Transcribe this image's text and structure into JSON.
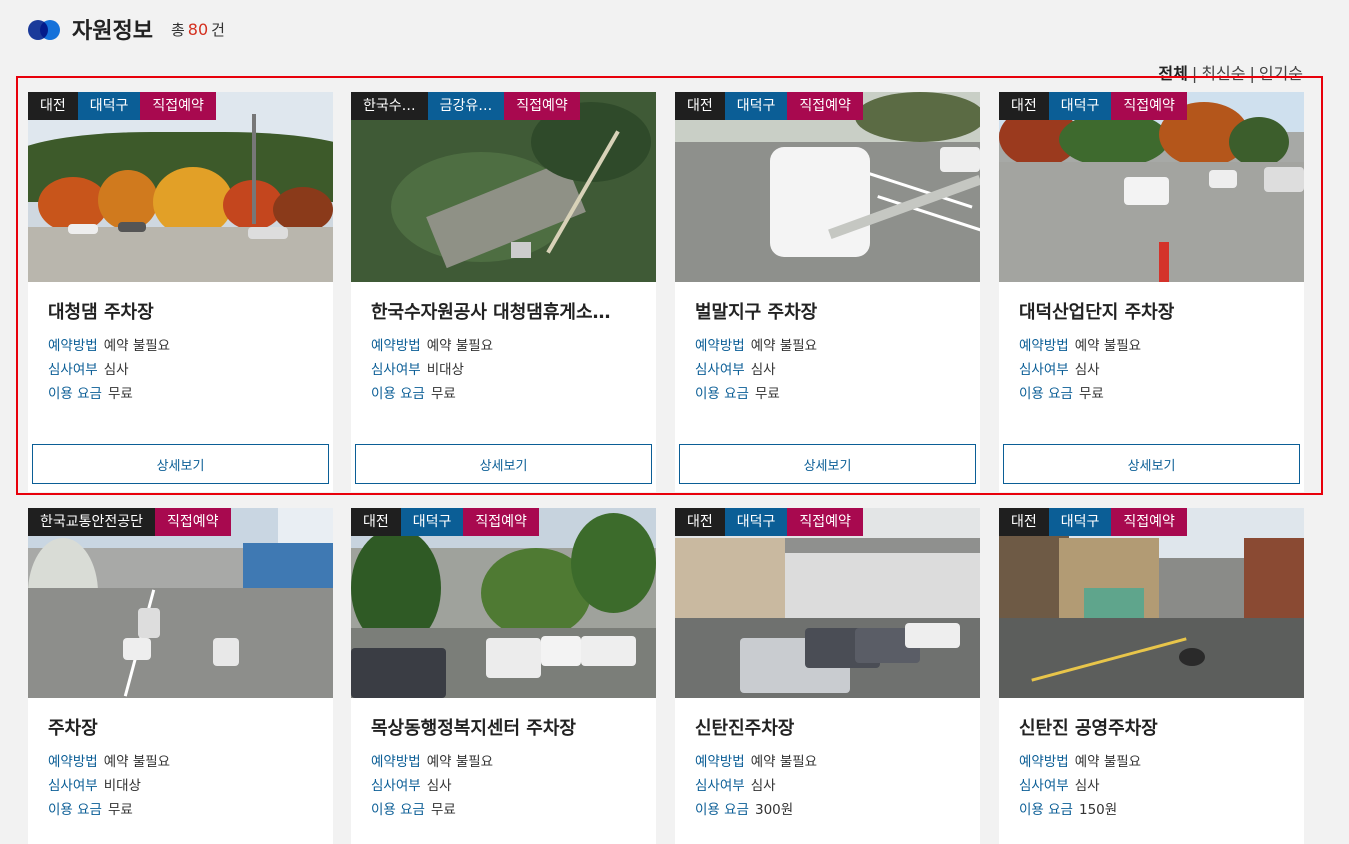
{
  "header": {
    "title": "자원정보",
    "total_prefix": "총",
    "total_count": "80",
    "total_suffix": "건"
  },
  "sort": {
    "options": [
      "전체",
      "최신순",
      "인기순"
    ],
    "separator": "|",
    "active": "전체"
  },
  "labels": {
    "reservation_method": "예약방법",
    "review": "심사여부",
    "fee": "이용 요금",
    "detail_button": "상세보기"
  },
  "cards": [
    {
      "tags": [
        "대전",
        "대덕구",
        "직접예약"
      ],
      "name": "대청댐 주차장",
      "reservation_method": "예약 불필요",
      "review": "심사",
      "fee": "무료"
    },
    {
      "tags": [
        "한국수…",
        "금강유…",
        "직접예약"
      ],
      "name": "한국수자원공사 대청댐휴게소…",
      "reservation_method": "예약 불필요",
      "review": "비대상",
      "fee": "무료"
    },
    {
      "tags": [
        "대전",
        "대덕구",
        "직접예약"
      ],
      "name": "벌말지구 주차장",
      "reservation_method": "예약 불필요",
      "review": "심사",
      "fee": "무료"
    },
    {
      "tags": [
        "대전",
        "대덕구",
        "직접예약"
      ],
      "name": "대덕산업단지 주차장",
      "reservation_method": "예약 불필요",
      "review": "심사",
      "fee": "무료"
    },
    {
      "tags": [
        "한국교통안전공단",
        "직접예약"
      ],
      "name": "주차장",
      "reservation_method": "예약 불필요",
      "review": "비대상",
      "fee": "무료"
    },
    {
      "tags": [
        "대전",
        "대덕구",
        "직접예약"
      ],
      "name": "목상동행정복지센터 주차장",
      "reservation_method": "예약 불필요",
      "review": "심사",
      "fee": "무료"
    },
    {
      "tags": [
        "대전",
        "대덕구",
        "직접예약"
      ],
      "name": "신탄진주차장",
      "reservation_method": "예약 불필요",
      "review": "심사",
      "fee": "300원"
    },
    {
      "tags": [
        "대전",
        "대덕구",
        "직접예약"
      ],
      "name": "신탄진 공영주차장",
      "reservation_method": "예약 불필요",
      "review": "심사",
      "fee": "150원"
    }
  ]
}
